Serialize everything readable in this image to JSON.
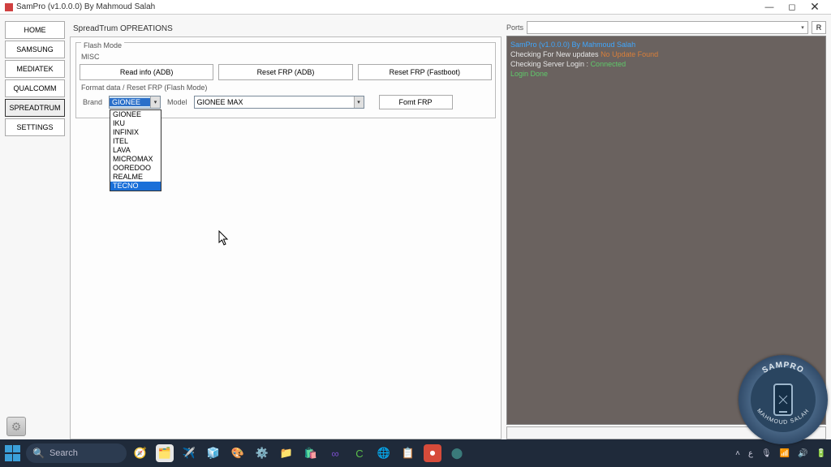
{
  "titlebar": {
    "title": "SamPro (v1.0.0.0) By Mahmoud Salah"
  },
  "sidebar": {
    "items": [
      "HOME",
      "SAMSUNG",
      "MEDIATEK",
      "QUALCOMM",
      "SPREADTRUM",
      "SETTINGS"
    ],
    "activeIndex": 4
  },
  "center": {
    "heading": "SpreadTrum OPREATIONS",
    "flashModeTitle": "Flash Mode",
    "miscLabel": "MISC",
    "buttons": {
      "readInfo": "Read info (ADB)",
      "resetFrpAdb": "Reset FRP (ADB)",
      "resetFrpFastboot": "Reset FRP (Fastboot)"
    },
    "formatSectionLabel": "Format data / Reset FRP (Flash Mode)",
    "brandLabel": "Brand",
    "modelLabel": "Model",
    "brandSelected": "GIONEE",
    "modelSelected": "GIONEE MAX",
    "fmtFrpBtn": "Fomt FRP",
    "brandOptions": [
      "GIONEE",
      "IKU",
      "INFINIX",
      "ITEL",
      "LAVA",
      "MICROMAX",
      "OOREDOO",
      "REALME",
      "TECNO"
    ],
    "hoverIndex": 8
  },
  "right": {
    "portsLabel": "Ports",
    "refresh": "R",
    "log": {
      "line1": "SamPro (v1.0.0.0) By Mahmoud Salah",
      "line2a": "Checking For New updates ",
      "line2b": "No Update Found",
      "line3a": "Checking Server Login : ",
      "line3b": "Connected",
      "line4": "Login Done"
    }
  },
  "badge": {
    "top": "SAMPRO",
    "bottom": "MAHMOUD SALAH"
  },
  "taskbar": {
    "searchPlaceholder": "Search",
    "time": "",
    "date": ""
  }
}
